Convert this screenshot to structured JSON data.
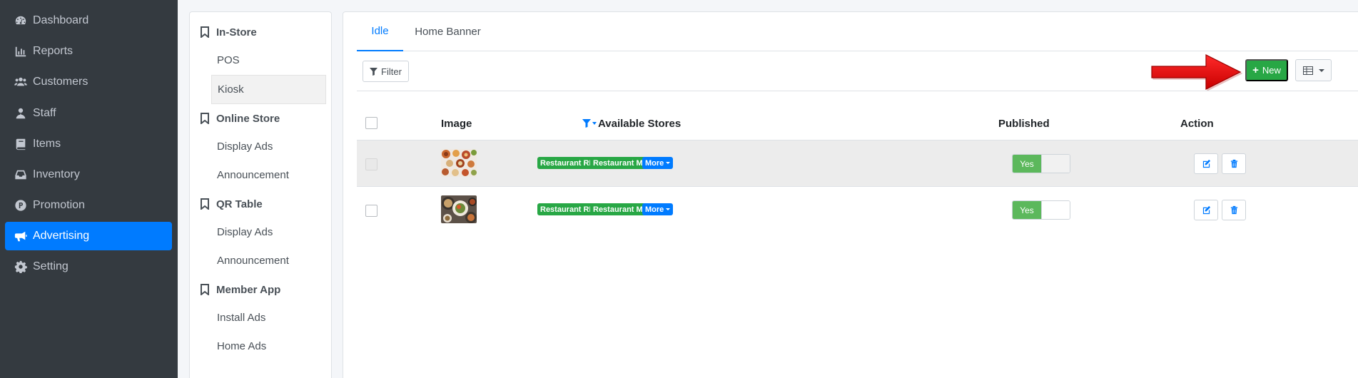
{
  "sidebar": {
    "items": [
      {
        "label": "Dashboard",
        "icon": "dashboard-icon"
      },
      {
        "label": "Reports",
        "icon": "bar-chart-icon"
      },
      {
        "label": "Customers",
        "icon": "users-icon"
      },
      {
        "label": "Staff",
        "icon": "user-tie-icon"
      },
      {
        "label": "Items",
        "icon": "book-icon"
      },
      {
        "label": "Inventory",
        "icon": "inbox-icon"
      },
      {
        "label": "Promotion",
        "icon": "promotion-p-icon"
      },
      {
        "label": "Advertising",
        "icon": "megaphone-icon"
      },
      {
        "label": "Setting",
        "icon": "gear-icon"
      }
    ],
    "active": "Advertising"
  },
  "subnav": {
    "groups": [
      {
        "title": "In-Store",
        "items": [
          "POS",
          "Kiosk"
        ]
      },
      {
        "title": "Online Store",
        "items": [
          "Display Ads",
          "Announcement"
        ]
      },
      {
        "title": "QR Table",
        "items": [
          "Display Ads",
          "Announcement"
        ]
      },
      {
        "title": "Member App",
        "items": [
          "Install Ads",
          "Home Ads"
        ]
      }
    ],
    "active_item": "Kiosk"
  },
  "tabs": [
    "Idle",
    "Home Banner"
  ],
  "active_tab": "Idle",
  "toolbar": {
    "filter_label": "Filter",
    "new_label": "New"
  },
  "table": {
    "headers": {
      "image": "Image",
      "stores": "Available Stores",
      "published": "Published",
      "action": "Action"
    },
    "rows": [
      {
        "stores": [
          "Restaurant RE",
          "Restaurant Mie"
        ],
        "more": "More",
        "published": "Yes",
        "thumb": "food-dishes-image"
      },
      {
        "stores": [
          "Restaurant RE",
          "Restaurant Mie"
        ],
        "more": "More",
        "published": "Yes",
        "thumb": "food-bowls-image"
      }
    ]
  },
  "colors": {
    "sidebar_bg": "#343a40",
    "primary": "#007bff",
    "success": "#28a745",
    "arrow": "#e00000"
  }
}
